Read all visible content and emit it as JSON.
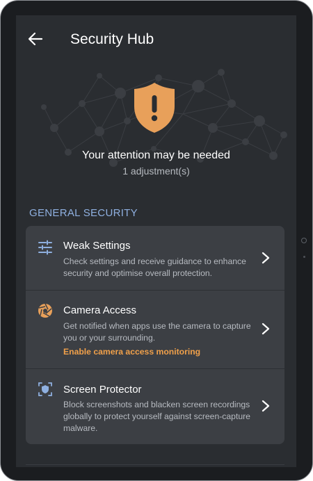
{
  "header": {
    "title": "Security Hub",
    "back_icon": "arrow-left-icon"
  },
  "status": {
    "icon": "shield-alert-icon",
    "title": "Your attention may be needed",
    "subtitle": "1 adjustment(s)"
  },
  "section": {
    "heading": "GENERAL SECURITY"
  },
  "items": [
    {
      "icon": "sliders-icon",
      "title": "Weak Settings",
      "description": "Check settings and receive guidance to enhance security and optimise overall protection."
    },
    {
      "icon": "camera-aperture-icon",
      "title": "Camera Access",
      "description": "Get notified when apps use the camera to capture you or your surrounding.",
      "link": "Enable camera access monitoring"
    },
    {
      "icon": "screen-protect-icon",
      "title": "Screen Protector",
      "description": "Block screenshots and blacken screen recordings globally to protect yourself against screen-capture malware."
    }
  ],
  "colors": {
    "accent": "#f0a04a",
    "shield": "#e8a05a",
    "section_heading": "#8fb0e0",
    "icon_blue": "#8fb0e0",
    "background": "#2a2d31",
    "card": "#3c3f44"
  }
}
